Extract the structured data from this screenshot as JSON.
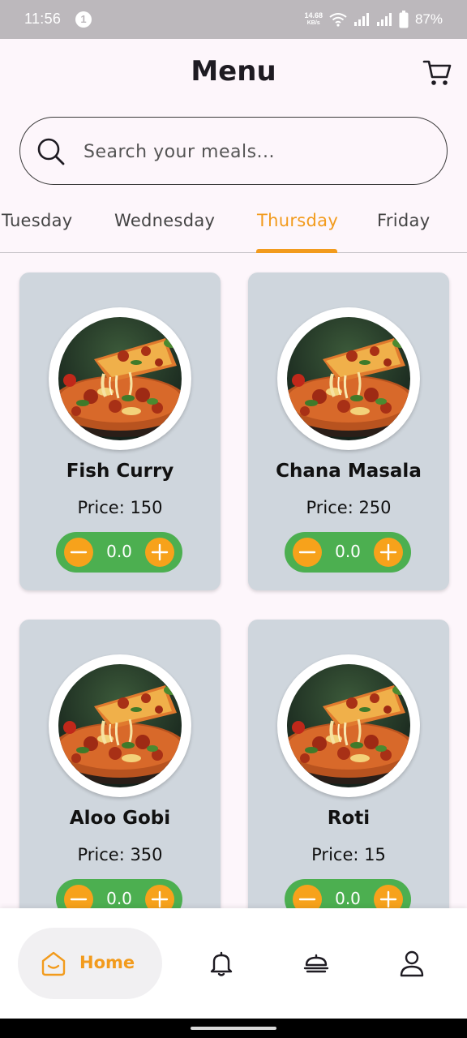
{
  "status_bar": {
    "time": "11:56",
    "notification_count": "1",
    "net_speed_value": "14.68",
    "net_speed_unit": "KB/s",
    "battery": "87%"
  },
  "header": {
    "title": "Menu",
    "cart_icon": "cart-icon"
  },
  "search": {
    "placeholder": "Search your meals...",
    "value": ""
  },
  "day_tabs": [
    {
      "label": "Tuesday",
      "active": false
    },
    {
      "label": "Wednesday",
      "active": false
    },
    {
      "label": "Thursday",
      "active": true
    },
    {
      "label": "Friday",
      "active": false
    }
  ],
  "meals": [
    {
      "name": "Fish Curry",
      "price": "Price: 150",
      "quantity": "0.0",
      "image": "pizza-photo"
    },
    {
      "name": "Chana Masala",
      "price": "Price: 250",
      "quantity": "0.0",
      "image": "pizza-photo"
    },
    {
      "name": "Aloo Gobi",
      "price": "Price: 350",
      "quantity": "0.0",
      "image": "pizza-photo"
    },
    {
      "name": "Roti",
      "price": "Price: 15",
      "quantity": "0.0",
      "image": "pizza-photo"
    }
  ],
  "bottom_nav": {
    "home_label": "Home",
    "items": [
      "home-icon",
      "bell-icon",
      "orders-icon",
      "profile-icon"
    ]
  },
  "colors": {
    "accent": "#f29b1d",
    "stepper": "#4caf50",
    "card": "#cfd6dd",
    "background": "#fdf6fb"
  }
}
